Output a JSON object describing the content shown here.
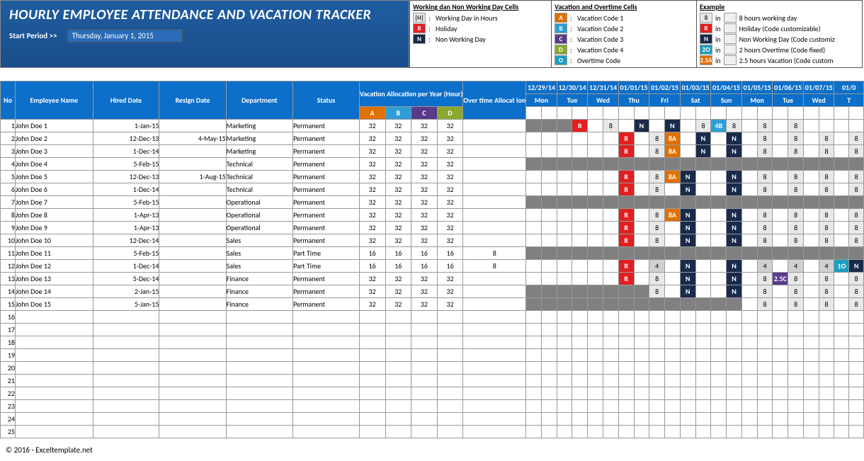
{
  "banner": {
    "title": "HOURLY EMPLOYEE ATTENDANCE AND VACATION TRACKER",
    "start_label": "Start Period >>",
    "start_date": "Thursday, January 1, 2015"
  },
  "legend1": {
    "title": "Working dan Non Working Day Cells",
    "rows": [
      {
        "chip": "[H]",
        "bg": "#e8e8e8",
        "fg": "#333",
        "text": "Working Day in Hours"
      },
      {
        "chip": "R",
        "bg": "#e02020",
        "fg": "#fff",
        "text": "Holiday"
      },
      {
        "chip": "N",
        "bg": "#1a2a4a",
        "fg": "#fff",
        "text": "Non Working Day"
      }
    ]
  },
  "legend2": {
    "title": "Vacation and Overtime Cells",
    "rows": [
      {
        "chip": "A",
        "bg": "#e07000",
        "fg": "#fff",
        "text": "Vacation Code 1"
      },
      {
        "chip": "B",
        "bg": "#2c9ed6",
        "fg": "#fff",
        "text": "Vacation Code 2"
      },
      {
        "chip": "C",
        "bg": "#5a3a8a",
        "fg": "#fff",
        "text": "Vacation Code 3"
      },
      {
        "chip": "D",
        "bg": "#8aa82e",
        "fg": "#fff",
        "text": "Vacation Code 4"
      },
      {
        "chip": "O",
        "bg": "#1aa0c0",
        "fg": "#fff",
        "text": "Overtime Code"
      }
    ]
  },
  "legend3": {
    "title": "Example",
    "rows": [
      {
        "chip": "8",
        "bg": "#e8e8e8",
        "fg": "#333",
        "text": "8 hours working day"
      },
      {
        "chip": "R",
        "bg": "#e02020",
        "fg": "#fff",
        "text": "Holiday (Code customizable)"
      },
      {
        "chip": "N",
        "bg": "#1a2a4a",
        "fg": "#fff",
        "text": "Non Working Day (Code customiz"
      },
      {
        "chip": "2O",
        "bg": "#1aa0c0",
        "fg": "#fff",
        "text": "2 hours Overtime (Code fixed)"
      },
      {
        "chip": "2.5A",
        "bg": "#e07000",
        "fg": "#fff",
        "text": "2.5 hours Vacation (Code custom"
      }
    ]
  },
  "headers": {
    "no": "No",
    "name": "Employee Name",
    "hired": "Hired Date",
    "resign": "Resign Date",
    "dept": "Department",
    "status": "Status",
    "vac": "Vacation Allocation per Year (Hour)",
    "ot": "Over time Allocat ion",
    "dates": [
      "12/29/14",
      "12/30/14",
      "12/31/14",
      "01/01/15",
      "01/02/15",
      "01/03/15",
      "01/04/15",
      "01/05/15",
      "01/06/15",
      "01/07/15",
      "01/0"
    ],
    "subvac": [
      "A",
      "B",
      "C",
      "D"
    ],
    "days": [
      "Mon",
      "Tue",
      "Wed",
      "Thu",
      "Fri",
      "Sat",
      "Sun",
      "Mon",
      "Tue",
      "Wed",
      "T"
    ]
  },
  "rows": [
    {
      "no": 1,
      "name": "John Doe 1",
      "hired": "1-Jan-15",
      "resign": "",
      "dept": "Marketing",
      "status": "Permanent",
      "vac": [
        32,
        32,
        32,
        32
      ],
      "ot": "",
      "cells": [
        "g",
        "g",
        "g",
        "R",
        "",
        "8",
        "",
        "N",
        "",
        "N",
        "",
        "8",
        "4B",
        "8",
        "",
        "8",
        "",
        "8"
      ]
    },
    {
      "no": 2,
      "name": "John Doe 2",
      "hired": "12-Dec-13",
      "resign": "4-May-15",
      "dept": "Marketing",
      "status": "Permanent",
      "vac": [
        32,
        32,
        32,
        32
      ],
      "ot": "",
      "cells": [
        "",
        "",
        "",
        "",
        "",
        "",
        "R",
        "",
        "8",
        "8A",
        "",
        "N",
        "",
        "N",
        "",
        "8",
        "",
        "8",
        "",
        "8",
        "",
        "8"
      ]
    },
    {
      "no": 3,
      "name": "John Doe 3",
      "hired": "1-Dec-14",
      "resign": "",
      "dept": "Marketing",
      "status": "Permanent",
      "vac": [
        32,
        32,
        32,
        32
      ],
      "ot": "",
      "cells": [
        "",
        "",
        "",
        "",
        "",
        "",
        "R",
        "",
        "8",
        "8A",
        "",
        "N",
        "",
        "N",
        "",
        "8",
        "",
        "8",
        "",
        "8",
        "",
        "8"
      ]
    },
    {
      "no": 4,
      "name": "John Doe 4",
      "hired": "5-Feb-15",
      "resign": "",
      "dept": "Technical",
      "status": "Permanent",
      "vac": [
        32,
        32,
        32,
        32
      ],
      "ot": "",
      "cells": [
        "g",
        "g",
        "g",
        "g",
        "g",
        "g",
        "g",
        "g",
        "g",
        "g",
        "g",
        "g",
        "g",
        "g",
        "g",
        "g",
        "g",
        "g",
        "g",
        "g",
        "g",
        "g"
      ]
    },
    {
      "no": 5,
      "name": "John Doe 5",
      "hired": "12-Dec-13",
      "resign": "1-Aug-15",
      "dept": "Technical",
      "status": "Permanent",
      "vac": [
        32,
        32,
        32,
        32
      ],
      "ot": "",
      "cells": [
        "",
        "",
        "",
        "",
        "",
        "",
        "R",
        "",
        "8",
        "8A",
        "N",
        "",
        "",
        "N",
        "",
        "8",
        "",
        "8",
        "",
        "8",
        "",
        "8"
      ]
    },
    {
      "no": 6,
      "name": "John Doe 6",
      "hired": "1-Dec-14",
      "resign": "",
      "dept": "Technical",
      "status": "Permanent",
      "vac": [
        32,
        32,
        32,
        32
      ],
      "ot": "",
      "cells": [
        "",
        "",
        "",
        "",
        "",
        "",
        "R",
        "",
        "8",
        "",
        "N",
        "",
        "",
        "N",
        "",
        "8",
        "",
        "8",
        "",
        "8",
        "",
        "8"
      ]
    },
    {
      "no": 7,
      "name": "John Doe 7",
      "hired": "5-Feb-15",
      "resign": "",
      "dept": "Operational",
      "status": "Permanent",
      "vac": [
        32,
        32,
        32,
        32
      ],
      "ot": "",
      "cells": [
        "g",
        "g",
        "g",
        "g",
        "g",
        "g",
        "g",
        "g",
        "g",
        "g",
        "g",
        "g",
        "g",
        "g",
        "g",
        "g",
        "g",
        "g",
        "g",
        "g",
        "g",
        "g"
      ]
    },
    {
      "no": 8,
      "name": "John Doe 8",
      "hired": "1-Apr-13",
      "resign": "",
      "dept": "Operational",
      "status": "Permanent",
      "vac": [
        32,
        32,
        32,
        32
      ],
      "ot": "",
      "cells": [
        "",
        "",
        "",
        "",
        "",
        "",
        "R",
        "",
        "8",
        "8A",
        "N",
        "",
        "",
        "N",
        "",
        "8",
        "",
        "8",
        "",
        "8",
        "",
        "8"
      ]
    },
    {
      "no": 9,
      "name": "John Doe 9",
      "hired": "1-Apr-13",
      "resign": "",
      "dept": "Operational",
      "status": "Permanent",
      "vac": [
        32,
        32,
        32,
        32
      ],
      "ot": "",
      "cells": [
        "",
        "",
        "",
        "",
        "",
        "",
        "R",
        "",
        "8",
        "",
        "N",
        "",
        "",
        "N",
        "",
        "8",
        "",
        "8",
        "",
        "8",
        "",
        "8"
      ]
    },
    {
      "no": 10,
      "name": "John Doe 10",
      "hired": "12-Dec-14",
      "resign": "",
      "dept": "Sales",
      "status": "Permanent",
      "vac": [
        32,
        32,
        32,
        32
      ],
      "ot": "",
      "cells": [
        "",
        "",
        "",
        "",
        "",
        "",
        "R",
        "",
        "8",
        "",
        "N",
        "",
        "",
        "N",
        "",
        "8",
        "",
        "8",
        "",
        "8",
        "",
        "8"
      ]
    },
    {
      "no": 11,
      "name": "John Doe 11",
      "hired": "5-Feb-15",
      "resign": "",
      "dept": "Sales",
      "status": "Part Time",
      "vac": [
        16,
        16,
        16,
        16
      ],
      "ot": "8",
      "cells": [
        "g",
        "g",
        "g",
        "g",
        "g",
        "g",
        "g",
        "g",
        "g",
        "g",
        "g",
        "g",
        "g",
        "g",
        "g",
        "g",
        "g",
        "g",
        "g",
        "g",
        "g",
        "g"
      ]
    },
    {
      "no": 12,
      "name": "John Doe 12",
      "hired": "1-Dec-14",
      "resign": "",
      "dept": "Sales",
      "status": "Part Time",
      "vac": [
        16,
        16,
        16,
        16
      ],
      "ot": "8",
      "cells": [
        "",
        "",
        "",
        "",
        "",
        "",
        "R",
        "",
        "4l",
        "",
        "N",
        "",
        "",
        "N",
        "",
        "4l",
        "",
        "4l",
        "",
        "4l",
        "1O",
        "N"
      ]
    },
    {
      "no": 13,
      "name": "John Doe 13",
      "hired": "5-Dec-14",
      "resign": "",
      "dept": "Finance",
      "status": "Permanent",
      "vac": [
        32,
        32,
        32,
        32
      ],
      "ot": "",
      "cells": [
        "",
        "",
        "",
        "",
        "",
        "",
        "R",
        "",
        "8",
        "",
        "N",
        "",
        "",
        "N",
        "",
        "8",
        "25C",
        "8",
        "",
        "8",
        "",
        "8"
      ]
    },
    {
      "no": 14,
      "name": "John Doe 14",
      "hired": "2-Jan-15",
      "resign": "",
      "dept": "Finance",
      "status": "Permanent",
      "vac": [
        32,
        32,
        32,
        32
      ],
      "ot": "",
      "cells": [
        "g",
        "g",
        "g",
        "g",
        "g",
        "g",
        "g",
        "g",
        "8",
        "",
        "N",
        "",
        "",
        "N",
        "",
        "8",
        "",
        "8",
        "",
        "8",
        "",
        "8"
      ]
    },
    {
      "no": 15,
      "name": "John Doe 15",
      "hired": "5-Jan-15",
      "resign": "",
      "dept": "Finance",
      "status": "Permanent",
      "vac": [
        32,
        32,
        32,
        32
      ],
      "ot": "",
      "cells": [
        "g",
        "g",
        "g",
        "g",
        "g",
        "g",
        "g",
        "g",
        "g",
        "g",
        "g",
        "g",
        "g",
        "g",
        "",
        "8",
        "",
        "8",
        "",
        "8",
        "",
        "8"
      ]
    }
  ],
  "empty_rows": [
    16,
    17,
    18,
    19,
    20,
    21,
    22,
    23,
    24,
    25
  ],
  "footer": "© 2016 - Exceltemplate.net"
}
